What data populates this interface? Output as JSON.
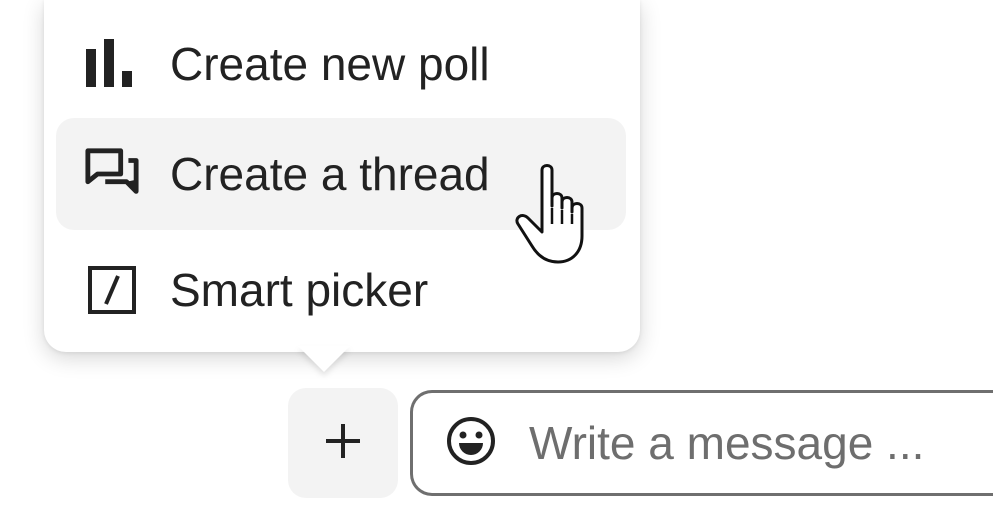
{
  "menu": {
    "items": [
      {
        "label": "Create new poll",
        "icon": "poll-icon",
        "hovered": false
      },
      {
        "label": "Create a thread",
        "icon": "thread-icon",
        "hovered": true
      },
      {
        "label": "Smart picker",
        "icon": "smart-picker-icon",
        "hovered": false
      }
    ]
  },
  "composer": {
    "add_icon": "plus-icon",
    "emoji_icon": "emoji-icon",
    "placeholder": "Write a message ..."
  },
  "cursor": {
    "icon": "hand-pointer-cursor-icon"
  },
  "colors": {
    "menu_background": "#ffffff",
    "hover_background": "#f3f3f3",
    "text": "#222222",
    "placeholder": "#6e6e6e",
    "field_border": "#6f6f6f"
  }
}
